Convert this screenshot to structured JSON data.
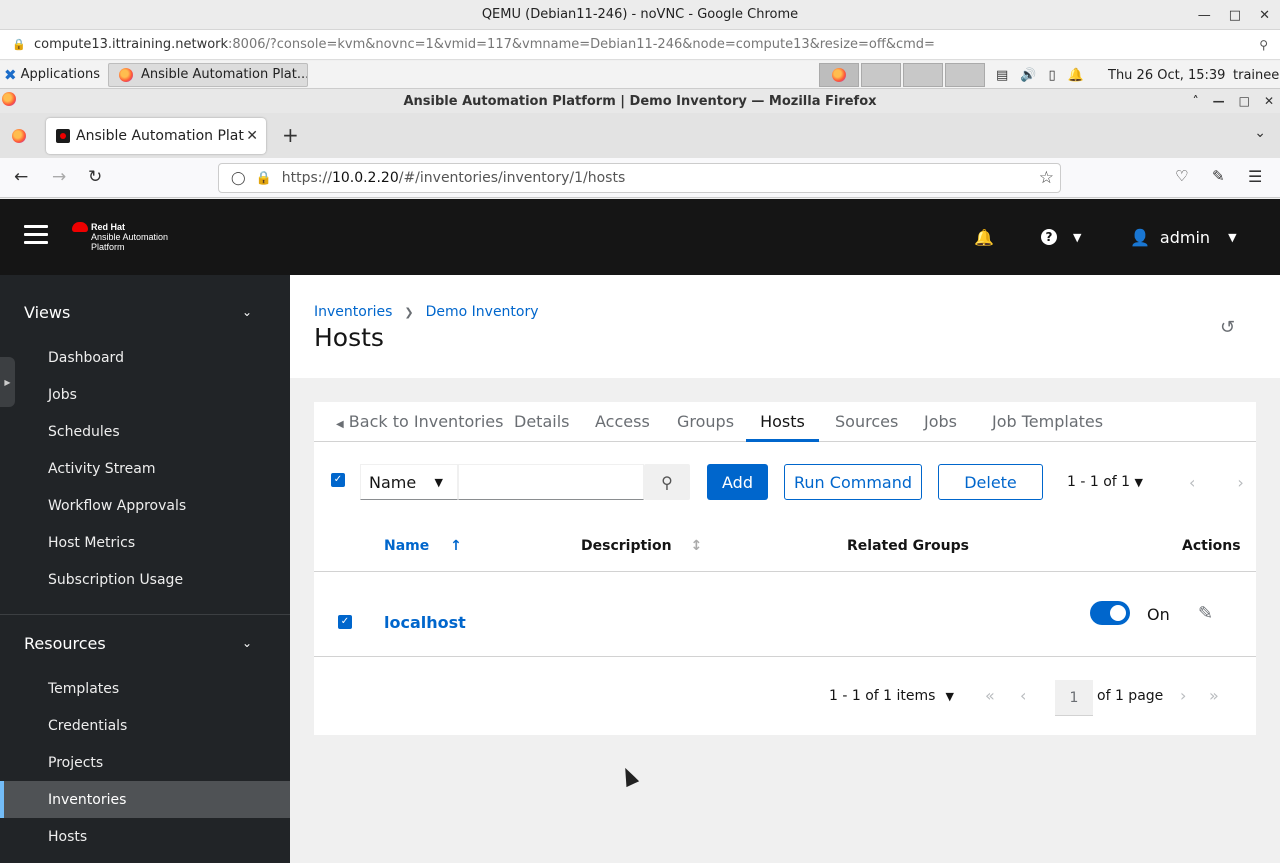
{
  "chrome": {
    "window_title": "QEMU (Debian11-246) - noVNC - Google Chrome",
    "url_host": "compute13.ittraining.network",
    "url_rest": ":8006/?console=kvm&novnc=1&vmid=117&vmname=Debian11-246&node=compute13&resize=off&cmd="
  },
  "panel": {
    "applications_label": "Applications",
    "task_label": "Ansible Automation Plat...",
    "clock": "Thu 26 Oct, 15:39",
    "user": "trainee"
  },
  "firefox": {
    "window_title": "Ansible Automation Platform | Demo Inventory — Mozilla Firefox",
    "tab_title": "Ansible Automation Platform",
    "url_prefix": "https://",
    "url_host": "10.0.2.20",
    "url_path": "/#/inventories/inventory/1/hosts"
  },
  "masthead": {
    "brand_line1": "Red Hat",
    "brand_line2": "Ansible Automation Platform",
    "user": "admin"
  },
  "sidebar": {
    "views_title": "Views",
    "views_items": [
      "Dashboard",
      "Jobs",
      "Schedules",
      "Activity Stream",
      "Workflow Approvals",
      "Host Metrics",
      "Subscription Usage"
    ],
    "resources_title": "Resources",
    "resources_items": [
      "Templates",
      "Credentials",
      "Projects",
      "Inventories",
      "Hosts"
    ],
    "current": "Inventories"
  },
  "page": {
    "breadcrumb_root": "Inventories",
    "breadcrumb_inventory": "Demo Inventory",
    "title": "Hosts"
  },
  "tabs": {
    "back": "Back to Inventories",
    "details": "Details",
    "access": "Access",
    "groups": "Groups",
    "hosts": "Hosts",
    "sources": "Sources",
    "jobs": "Jobs",
    "job_templates": "Job Templates",
    "active": "Hosts"
  },
  "toolbar": {
    "filter_key": "Name",
    "search_value": "",
    "add_label": "Add",
    "run_command_label": "Run Command",
    "delete_label": "Delete",
    "pagination": "1 - 1 of 1"
  },
  "table": {
    "col_name": "Name",
    "col_description": "Description",
    "col_related_groups": "Related Groups",
    "col_actions": "Actions",
    "rows": [
      {
        "name": "localhost",
        "description": "",
        "related_groups": "",
        "enabled": true,
        "toggle_label": "On",
        "selected": true
      }
    ]
  },
  "pagination_bottom": {
    "items": "1 - 1 of 1 items",
    "page": "1",
    "of_pages": "of 1 page"
  },
  "colors": {
    "accent": "#0066cc",
    "masthead": "#151515",
    "sidebar": "#212427"
  }
}
